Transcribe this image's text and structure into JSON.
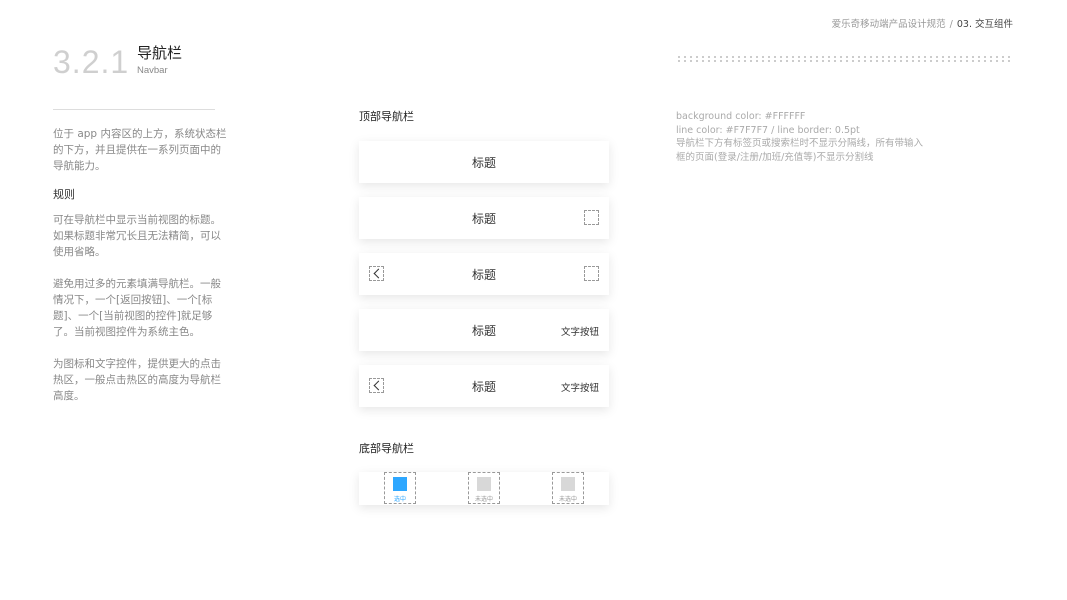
{
  "header": {
    "doc_title": "爱乐奇移动端产品设计规范",
    "separator": "/",
    "chapter": "03. 交互组件"
  },
  "section": {
    "number": "3.2.1",
    "title": "导航栏",
    "subtitle": "Navbar"
  },
  "intro": "位于 app 内容区的上方，系统状态栏的下方，并且提供在一系列页面中的导航能力。",
  "rules": {
    "heading": "规则",
    "items": [
      "可在导航栏中显示当前视图的标题。如果标题非常冗长且无法精简，可以使用省略。",
      "避免用过多的元素填满导航栏。一般情况下，一个[返回按钮]、一个[标题]、一个[当前视图的控件]就足够了。当前视图控件为系统主色。",
      "为图标和文字控件，提供更大的点击热区，一般点击热区的高度为导航栏高度。"
    ]
  },
  "top_nav": {
    "label": "顶部导航栏",
    "bars": [
      {
        "title": "标题"
      },
      {
        "title": "标题"
      },
      {
        "title": "标题"
      },
      {
        "title": "标题",
        "action_text": "文字按钮"
      },
      {
        "title": "标题",
        "action_text": "文字按钮"
      }
    ]
  },
  "bottom_nav": {
    "label": "底部导航栏",
    "tabs": [
      {
        "label": "选中",
        "active": true
      },
      {
        "label": "未选中",
        "active": false
      },
      {
        "label": "未选中",
        "active": false
      }
    ],
    "active_color": "#2EA7FF",
    "inactive_color": "#D8D8D8"
  },
  "spec": {
    "lines": [
      "background color: #FFFFFF",
      "line color: #F7F7F7 / line border: 0.5pt",
      "导航栏下方有标签页或搜索栏时不显示分隔线，所有带输入",
      "框的页面(登录/注册/加班/充值等)不显示分割线"
    ]
  }
}
